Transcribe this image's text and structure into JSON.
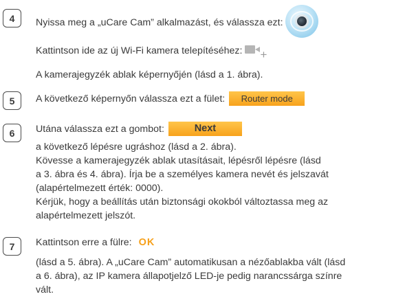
{
  "steps": {
    "s4": {
      "number": "4",
      "line1": "Nyissa meg a „uCare Cam” alkalmazást, és válassza ezt:",
      "line2": "Kattintson ide az új Wi-Fi kamera telepítéséhez:",
      "line3": "A kamerajegyzék ablak képernyőjén (lásd a 1. ábra).",
      "icon1": "ucare-cam-app-icon",
      "icon2": "add-camera-icon"
    },
    "s5": {
      "number": "5",
      "line1": "A következő képernyőn válassza ezt a fület:",
      "button": "Router mode"
    },
    "s6": {
      "number": "6",
      "line1": "Utána válassza ezt a gombot:",
      "button": "Next",
      "line2": "a következő lépésre ugráshoz (lásd a 2. ábra).",
      "line3": "Kövesse a kamerajegyzék ablak utasításait, lépésről lépésre (lásd",
      "line4": "a 3. ábra és 4. ábra). Írja be a személyes kamera nevét és jelszavát",
      "line5": "(alapértelmezett érték: 0000).",
      "line6": "Kérjük, hogy a beállítás után biztonsági okokból változtassa meg az",
      "line7": "alapértelmezett jelszót."
    },
    "s7": {
      "number": "7",
      "line1": "Kattintson erre a fülre:",
      "button": "OK",
      "line2": "(lásd a 5. ábra). A „uCare Cam” automatikusan a nézőablakba vált (lásd",
      "line3": "a 6. ábra), az IP kamera állapotjelző LED-je pedig narancssárga színre",
      "line4": "vált."
    }
  },
  "colors": {
    "accent_orange": "#f7a21c",
    "text": "#3a3a3a",
    "icon_gray": "#b5b5b5"
  }
}
